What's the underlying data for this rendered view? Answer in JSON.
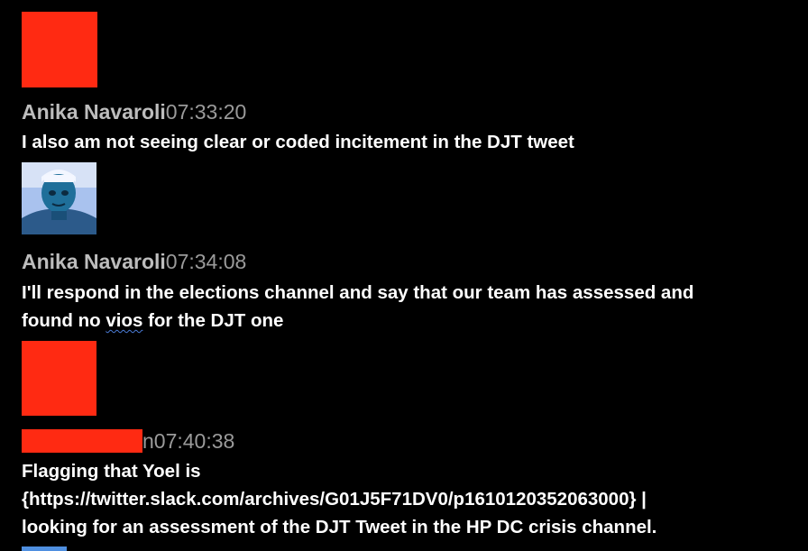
{
  "messages": [
    {
      "author": "Anika Navaroli",
      "time": "07:33:20",
      "avatar": "redacted",
      "lines": [
        "I also am not seeing clear or coded incitement in the DJT tweet"
      ]
    },
    {
      "author": "Anika Navaroli",
      "time": "07:34:08",
      "avatar": "photo",
      "lines": [
        "I'll respond in the elections channel and say that our team has assessed and"
      ],
      "line2_before": "found no ",
      "line2_flagged": "vios",
      "line2_after": " for the DJT one"
    },
    {
      "author_visible_suffix": "n",
      "time": "07:40:38",
      "avatar": "redacted",
      "lines": [
        "Flagging that Yoel is",
        "{https://twitter.slack.com/archives/G01J5F71DV0/p1610120352063000} |",
        "looking for an assessment of the DJT Tweet in the HP DC crisis channel."
      ]
    }
  ],
  "colors": {
    "background": "#000000",
    "redaction": "#ff2a12",
    "author": "#bdbdbd",
    "timestamp": "#9a9a9a",
    "message_text": "#ffffff",
    "spellcheck_underline": "#4a7bd6"
  }
}
